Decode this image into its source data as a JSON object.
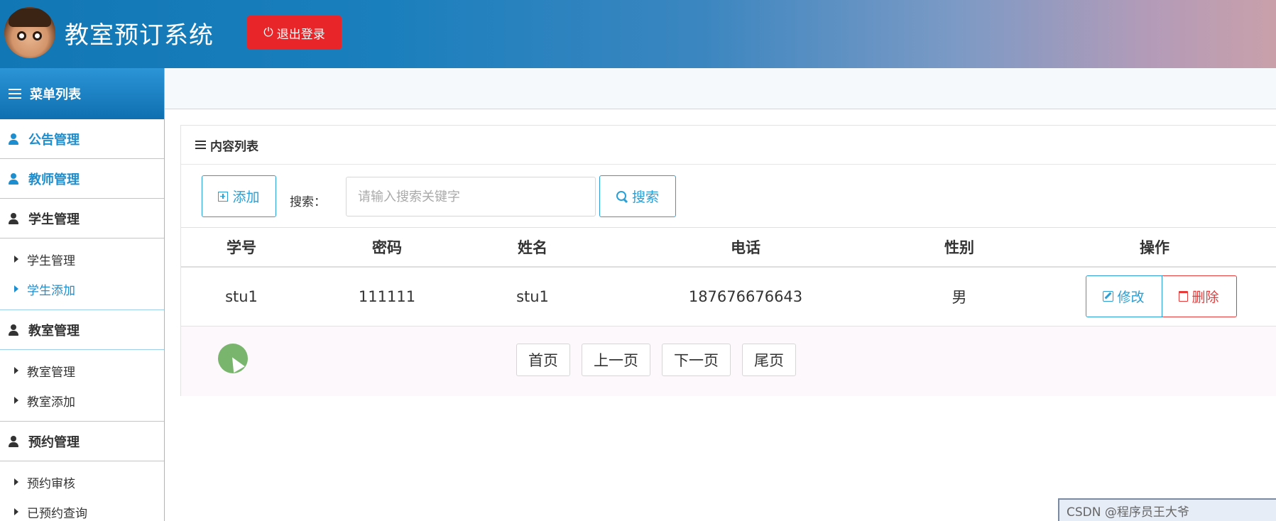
{
  "header": {
    "app_title": "教室预订系统",
    "logout_label": "退出登录",
    "logout_color": "#e8262a"
  },
  "sidebar": {
    "menu_title": "菜单列表",
    "items": [
      {
        "label": "公告管理",
        "type": "group",
        "active": true
      },
      {
        "label": "教师管理",
        "type": "group",
        "active": true
      },
      {
        "label": "学生管理",
        "type": "group"
      },
      {
        "label": "学生管理",
        "type": "sub"
      },
      {
        "label": "学生添加",
        "type": "sub",
        "active": true
      },
      {
        "label": "教室管理",
        "type": "group"
      },
      {
        "label": "教室管理",
        "type": "sub"
      },
      {
        "label": "教室添加",
        "type": "sub"
      },
      {
        "label": "预约管理",
        "type": "group"
      },
      {
        "label": "预约审核",
        "type": "sub"
      },
      {
        "label": "已预约查询",
        "type": "sub"
      }
    ]
  },
  "panel": {
    "title": "内容列表",
    "add_label": "添加",
    "search_label": "搜索：",
    "search_placeholder": "请输入搜索关键字",
    "search_value": "",
    "search_button": "搜索"
  },
  "table": {
    "columns": [
      "学号",
      "密码",
      "姓名",
      "电话",
      "性别",
      "操作"
    ],
    "rows": [
      {
        "id": "stu1",
        "password": "111111",
        "name": "stu1",
        "phone": "187676676643",
        "sex": "男",
        "edit_label": "修改",
        "delete_label": "删除"
      }
    ]
  },
  "pager": {
    "first": "首页",
    "prev": "上一页",
    "next": "下一页",
    "last": "尾页"
  },
  "watermark": "CSDN @程序员王大爷",
  "colors": {
    "accent": "#2a9fd6",
    "danger": "#e53b3b",
    "header_gradient_start": "#1277b5"
  }
}
